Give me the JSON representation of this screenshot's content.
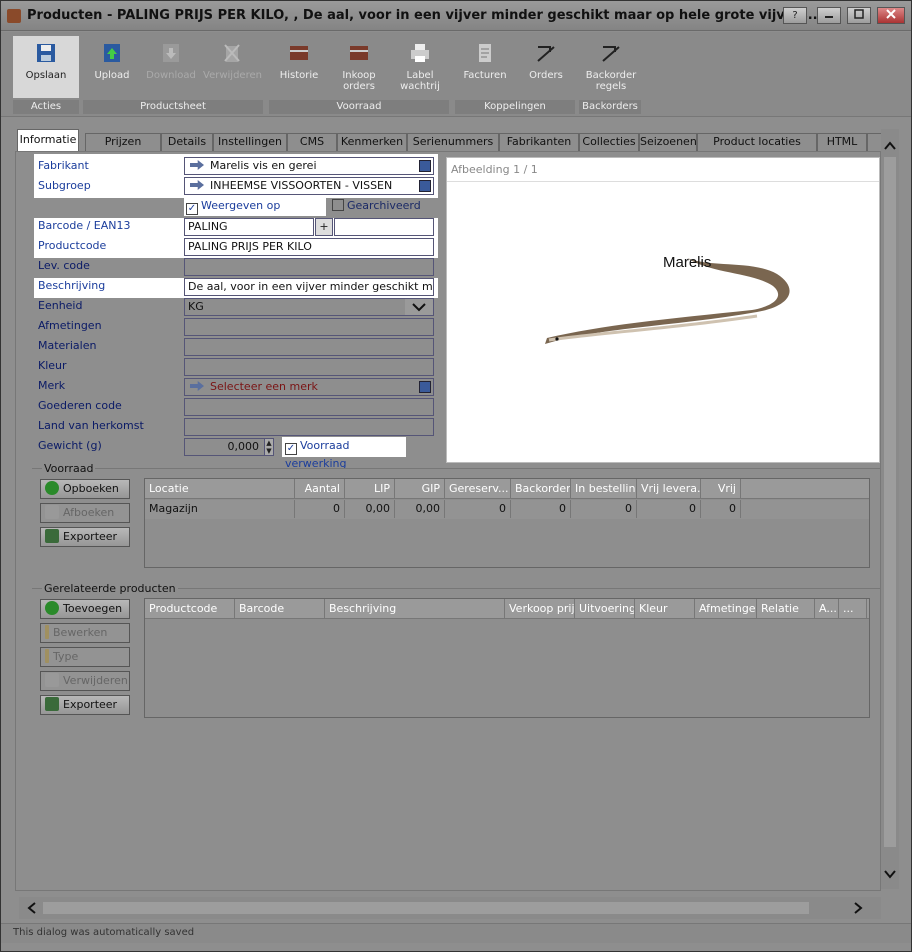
{
  "window": {
    "title": "Producten - PALING PRIJS PER KILO, , De aal, voor in een vijver minder geschikt maar op hele grote vijvers...",
    "help_label": "?"
  },
  "ribbon": {
    "buttons": [
      {
        "label": "Opslaan",
        "icon": "save-icon",
        "active": true
      },
      {
        "label": "Upload",
        "icon": "upload-icon"
      },
      {
        "label": "Download",
        "icon": "download-icon",
        "disabled": true
      },
      {
        "label": "Verwijderen",
        "icon": "delete-icon",
        "disabled": true
      },
      {
        "label": "Historie",
        "icon": "history-icon"
      },
      {
        "label": "Inkoop orders",
        "icon": "purchase-orders-icon"
      },
      {
        "label": "Label wachtrij",
        "icon": "printer-icon"
      },
      {
        "label": "Facturen",
        "icon": "invoices-icon"
      },
      {
        "label": "Orders",
        "icon": "orders-icon"
      },
      {
        "label": "Backorder regels",
        "icon": "backorder-icon"
      }
    ],
    "groups": [
      "Acties",
      "Productsheet",
      "Voorraad",
      "Koppelingen",
      "Backorders"
    ]
  },
  "tabs": [
    "Informatie",
    "Prijzen",
    "Details",
    "Instellingen",
    "CMS",
    "Kenmerken",
    "Serienummers",
    "Fabrikanten",
    "Collecties",
    "Seizoenen",
    "Product locaties",
    "HTML"
  ],
  "active_tab": "Informatie",
  "form": {
    "fabrikant_label": "Fabrikant",
    "fabrikant_value": "Marelis vis en gerei",
    "subgroep_label": "Subgroep",
    "subgroep_value": "INHEEMSE VISSOORTEN - VISSEN",
    "webshop_label": "Weergeven op webshop",
    "webshop_checked": true,
    "archived_label": "Gearchiveerd",
    "archived_checked": false,
    "barcode_label": "Barcode / EAN13",
    "barcode_value": "PALING",
    "barcode_add": "+",
    "productcode_label": "Productcode",
    "productcode_value": "PALING PRIJS PER KILO",
    "levcode_label": "Lev. code",
    "beschrijving_label": "Beschrijving",
    "beschrijving_value": "De aal, voor in een vijver minder geschikt maar op hele grote vijvers",
    "eenheid_label": "Eenheid",
    "eenheid_value": "KG",
    "afmetingen_label": "Afmetingen",
    "materialen_label": "Materialen",
    "kleur_label": "Kleur",
    "merk_label": "Merk",
    "merk_placeholder": "Selecteer een merk",
    "goederencode_label": "Goederen code",
    "herkomst_label": "Land van herkomst",
    "gewicht_label": "Gewicht (g)",
    "gewicht_value": "0,000",
    "voorraad_verwerking_label": "Voorraad verwerking",
    "voorraad_verwerking_checked": true
  },
  "image_panel": {
    "counter": "Afbeelding 1 / 1",
    "watermark": "Marelis"
  },
  "voorraad": {
    "title": "Voorraad",
    "buttons": [
      {
        "label": "Opboeken",
        "icon": "add-icon"
      },
      {
        "label": "Afboeken",
        "icon": "remove-icon",
        "disabled": true
      },
      {
        "label": "Exporteer",
        "icon": "export-icon"
      }
    ],
    "columns": [
      "Locatie",
      "Aantal",
      "LIP",
      "GIP",
      "Gereserv...",
      "Backorder",
      "In bestelling",
      "Vrij levera...",
      "Vrij"
    ],
    "rows": [
      [
        "Magazijn",
        "0",
        "0,00",
        "0,00",
        "0",
        "0",
        "0",
        "0",
        "0"
      ]
    ]
  },
  "gerelateerd": {
    "title": "Gerelateerde producten",
    "buttons": [
      {
        "label": "Toevoegen",
        "icon": "add-icon"
      },
      {
        "label": "Bewerken",
        "icon": "edit-icon",
        "disabled": true
      },
      {
        "label": "Type",
        "icon": "edit-icon",
        "disabled": true
      },
      {
        "label": "Verwijderen",
        "icon": "delete-icon",
        "disabled": true
      },
      {
        "label": "Exporteer",
        "icon": "export-icon"
      }
    ],
    "columns": [
      "Productcode",
      "Barcode",
      "Beschrijving",
      "Verkoop prijs",
      "Uitvoering",
      "Kleur",
      "Afmetingen",
      "Relatie",
      "A...",
      "..."
    ]
  },
  "status": "This dialog was automatically saved"
}
